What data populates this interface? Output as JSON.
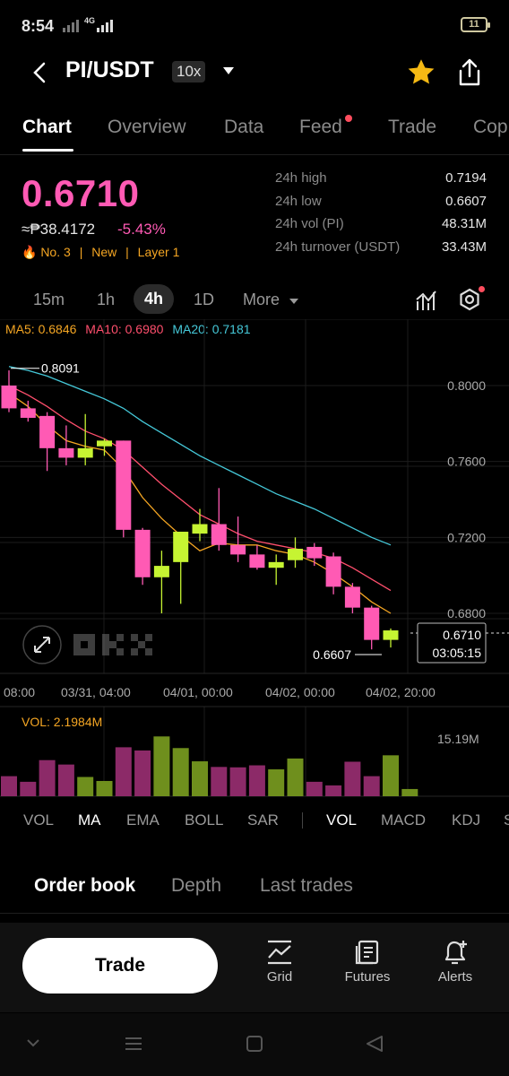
{
  "status": {
    "time": "8:54",
    "network": "4G",
    "battery": "11"
  },
  "header": {
    "pair": "PI/USDT",
    "leverage": "10x"
  },
  "tabs": [
    "Chart",
    "Overview",
    "Data",
    "Feed",
    "Trade",
    "Cop"
  ],
  "price": {
    "last": "0.6710",
    "fiat": "≈₱38.4172",
    "change": "-5.43%",
    "tags": [
      "🔥 No. 3",
      "|",
      "New",
      "|",
      "Layer 1"
    ]
  },
  "stats": [
    {
      "k": "24h high",
      "v": "0.7194"
    },
    {
      "k": "24h low",
      "v": "0.6607"
    },
    {
      "k": "24h vol (PI)",
      "v": "48.31M"
    },
    {
      "k": "24h turnover (USDT)",
      "v": "33.43M"
    }
  ],
  "intervals": [
    "15m",
    "1h",
    "4h",
    "1D",
    "More"
  ],
  "ma": {
    "ma5": "MA5: 0.6846",
    "ma10": "MA10: 0.6980",
    "ma20": "MA20: 0.7181"
  },
  "colors": {
    "up": "#c6f432",
    "down": "#ff5ab4",
    "ma5": "#f5a623",
    "ma10": "#ff4f6d",
    "ma20": "#45c8d8"
  },
  "chart_data": {
    "type": "candlestick",
    "interval": "4h",
    "price_ticks": [
      "0.8000",
      "0.7600",
      "0.7200",
      "0.6800"
    ],
    "time_ticks": [
      "08:00",
      "03/31, 04:00",
      "04/01, 00:00",
      "04/02, 00:00",
      "04/02, 20:00"
    ],
    "ylim": [
      0.655,
      0.823
    ],
    "high_label": "0.8091",
    "low_label": "0.6607",
    "last_label": "0.6710",
    "countdown": "03:05:15",
    "candles": [
      {
        "o": 0.8,
        "h": 0.808,
        "c": 0.788,
        "l": 0.786
      },
      {
        "o": 0.788,
        "h": 0.792,
        "c": 0.783,
        "l": 0.781
      },
      {
        "o": 0.784,
        "h": 0.786,
        "c": 0.767,
        "l": 0.755
      },
      {
        "o": 0.767,
        "h": 0.779,
        "c": 0.762,
        "l": 0.758
      },
      {
        "o": 0.762,
        "h": 0.785,
        "c": 0.767,
        "l": 0.758
      },
      {
        "o": 0.768,
        "h": 0.772,
        "c": 0.771,
        "l": 0.763
      },
      {
        "o": 0.771,
        "h": 0.771,
        "c": 0.724,
        "l": 0.72
      },
      {
        "o": 0.724,
        "h": 0.725,
        "c": 0.699,
        "l": 0.695
      },
      {
        "o": 0.699,
        "h": 0.713,
        "c": 0.705,
        "l": 0.68
      },
      {
        "o": 0.707,
        "h": 0.723,
        "c": 0.723,
        "l": 0.685
      },
      {
        "o": 0.722,
        "h": 0.735,
        "c": 0.727,
        "l": 0.718
      },
      {
        "o": 0.727,
        "h": 0.746,
        "c": 0.716,
        "l": 0.713
      },
      {
        "o": 0.716,
        "h": 0.731,
        "c": 0.711,
        "l": 0.707
      },
      {
        "o": 0.711,
        "h": 0.716,
        "c": 0.704,
        "l": 0.703
      },
      {
        "o": 0.704,
        "h": 0.711,
        "c": 0.707,
        "l": 0.695
      },
      {
        "o": 0.708,
        "h": 0.72,
        "c": 0.714,
        "l": 0.704
      },
      {
        "o": 0.715,
        "h": 0.717,
        "c": 0.709,
        "l": 0.705
      },
      {
        "o": 0.71,
        "h": 0.712,
        "c": 0.694,
        "l": 0.69
      },
      {
        "o": 0.694,
        "h": 0.696,
        "c": 0.683,
        "l": 0.68
      },
      {
        "o": 0.683,
        "h": 0.684,
        "c": 0.666,
        "l": 0.661
      },
      {
        "o": 0.666,
        "h": 0.672,
        "c": 0.671,
        "l": 0.662
      }
    ],
    "ma5": [
      0.796,
      0.789,
      0.779,
      0.771,
      0.768,
      0.766,
      0.756,
      0.741,
      0.73,
      0.721,
      0.713,
      0.717,
      0.716,
      0.716,
      0.713,
      0.711,
      0.707,
      0.701,
      0.694,
      0.686,
      0.68
    ],
    "ma10": [
      0.8,
      0.795,
      0.789,
      0.782,
      0.776,
      0.772,
      0.766,
      0.757,
      0.748,
      0.74,
      0.732,
      0.727,
      0.722,
      0.718,
      0.716,
      0.714,
      0.712,
      0.709,
      0.704,
      0.698,
      0.692
    ],
    "ma20": [
      0.81,
      0.808,
      0.805,
      0.801,
      0.797,
      0.793,
      0.788,
      0.781,
      0.775,
      0.769,
      0.763,
      0.758,
      0.753,
      0.748,
      0.743,
      0.739,
      0.735,
      0.73,
      0.725,
      0.72,
      0.716
    ],
    "volume": {
      "label": "VOL: 2.1984M",
      "max_label": "15.19M",
      "max": 15.19,
      "values": [
        5.0,
        3.6,
        9.0,
        7.9,
        4.8,
        3.8,
        12.2,
        11.4,
        14.9,
        12.0,
        8.7,
        7.3,
        7.2,
        7.7,
        6.7,
        9.4,
        3.6,
        2.7,
        8.6,
        5.0,
        10.2,
        1.8
      ]
    }
  },
  "indicators_main": [
    "VOL",
    "MA",
    "EMA",
    "BOLL",
    "SAR"
  ],
  "indicators_sub": [
    "VOL",
    "MACD",
    "KDJ",
    "S"
  ],
  "order_tabs": [
    "Order book",
    "Depth",
    "Last trades"
  ],
  "actions": {
    "trade": "Trade",
    "grid": "Grid",
    "futures": "Futures",
    "alerts": "Alerts"
  }
}
